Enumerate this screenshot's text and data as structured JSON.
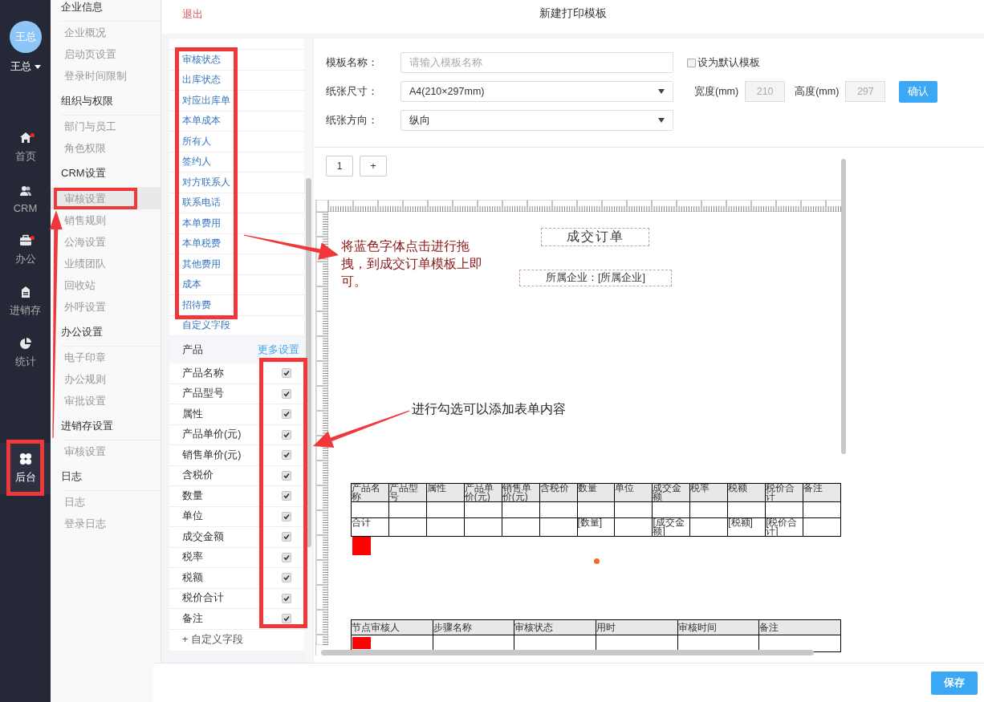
{
  "nav": {
    "user": {
      "avatar": "王总",
      "name": "王总"
    },
    "main_items": [
      {
        "label": "首页",
        "badge": true,
        "selected": false
      },
      {
        "label": "CRM",
        "badge": false,
        "selected": false
      },
      {
        "label": "办公",
        "badge": true,
        "selected": false
      },
      {
        "label": "进销存",
        "badge": false,
        "selected": false
      },
      {
        "label": "统计",
        "badge": false,
        "selected": false
      }
    ],
    "bottom_items": [
      {
        "label": "后台",
        "badge": false,
        "selected": true
      }
    ]
  },
  "settings_menu": [
    {
      "title": "企业信息",
      "items": [
        {
          "label": "企业概况",
          "selected": false
        },
        {
          "label": "启动页设置",
          "selected": false
        },
        {
          "label": "登录时间限制",
          "selected": false
        }
      ]
    },
    {
      "title": "组织与权限",
      "items": [
        {
          "label": "部门与员工",
          "selected": false
        },
        {
          "label": "角色权限",
          "selected": false
        }
      ]
    },
    {
      "title": "CRM设置",
      "items": [
        {
          "label": "审核设置",
          "selected": true
        },
        {
          "label": "销售规则",
          "selected": false
        },
        {
          "label": "公海设置",
          "selected": false
        },
        {
          "label": "业绩团队",
          "selected": false
        },
        {
          "label": "回收站",
          "selected": false
        },
        {
          "label": "外呼设置",
          "selected": false
        }
      ]
    },
    {
      "title": "办公设置",
      "items": [
        {
          "label": "电子印章",
          "selected": false
        },
        {
          "label": "办公规则",
          "selected": false
        },
        {
          "label": "审批设置",
          "selected": false
        }
      ]
    },
    {
      "title": "进销存设置",
      "items": [
        {
          "label": "审核设置",
          "selected": false
        }
      ]
    },
    {
      "title": "日志",
      "items": [
        {
          "label": "日志",
          "selected": false
        },
        {
          "label": "登录日志",
          "selected": false
        }
      ]
    }
  ],
  "header": {
    "back": "退出",
    "title": "新建打印模板"
  },
  "fields_panel": {
    "order_fields": [
      "审核状态",
      "出库状态",
      "对应出库单",
      "本单成本",
      "所有人",
      "签约人",
      "对方联系人",
      "联系电话",
      "本单费用",
      "本单税费",
      "其他费用",
      "成本",
      "招待费"
    ],
    "custom_field": "自定义字段",
    "product": {
      "title": "产品",
      "more": "更多设置",
      "fields": [
        {
          "label": "产品名称",
          "checked": true
        },
        {
          "label": "产品型号",
          "checked": true
        },
        {
          "label": "属性",
          "checked": true
        },
        {
          "label": "产品单价(元)",
          "checked": true
        },
        {
          "label": "销售单价(元)",
          "checked": true
        },
        {
          "label": "含税价",
          "checked": true
        },
        {
          "label": "数量",
          "checked": true
        },
        {
          "label": "单位",
          "checked": true
        },
        {
          "label": "成交金额",
          "checked": true
        },
        {
          "label": "税率",
          "checked": true
        },
        {
          "label": "税额",
          "checked": true
        },
        {
          "label": "税价合计",
          "checked": true
        },
        {
          "label": "备注",
          "checked": true
        }
      ],
      "add": "+ 自定义字段"
    }
  },
  "form": {
    "name": {
      "label": "模板名称：",
      "placeholder": "请输入模板名称"
    },
    "default_template": {
      "label": "设为默认模板",
      "checked": false
    },
    "paper_size": {
      "label": "纸张尺寸：",
      "value": "A4(210×297mm)"
    },
    "width": {
      "label": "宽度(mm)",
      "value": "210",
      "disabled": true
    },
    "height": {
      "label": "高度(mm)",
      "value": "297",
      "disabled": true
    },
    "confirm": "确认",
    "orientation": {
      "label": "纸张方向：",
      "value": "纵向"
    }
  },
  "pages": [
    "1",
    "+"
  ],
  "canvas": {
    "title": "成交订单",
    "company": "所属企业：[所属企业]",
    "product_table": {
      "columns": [
        "产品名称",
        "产品型号",
        "属性",
        "产品单价(元)",
        "销售单价(元)",
        "含税价",
        "数量",
        "单位",
        "成交金额",
        "税率",
        "税额",
        "税价合计",
        "备注"
      ],
      "rows": [
        [
          "",
          "",
          "",
          "",
          "",
          "",
          "",
          "",
          "",
          "",
          "",
          "",
          ""
        ],
        [
          "合计",
          "",
          "",
          "",
          "",
          "",
          "[数量]",
          "",
          "[成交金额]",
          "",
          "[税额]",
          "[税价合计]",
          ""
        ]
      ]
    },
    "approval_table": {
      "columns": [
        "节点审核人",
        "步骤名称",
        "审核状态",
        "用时",
        "审核时间",
        "备注"
      ],
      "rows": [
        [
          "",
          "",
          "",
          "",
          "",
          ""
        ]
      ]
    }
  },
  "annotations": [
    "将蓝色字体点击进行拖拽，到成交订单模板上即可。",
    "进行勾选可以添加表单内容"
  ],
  "save": "保存"
}
